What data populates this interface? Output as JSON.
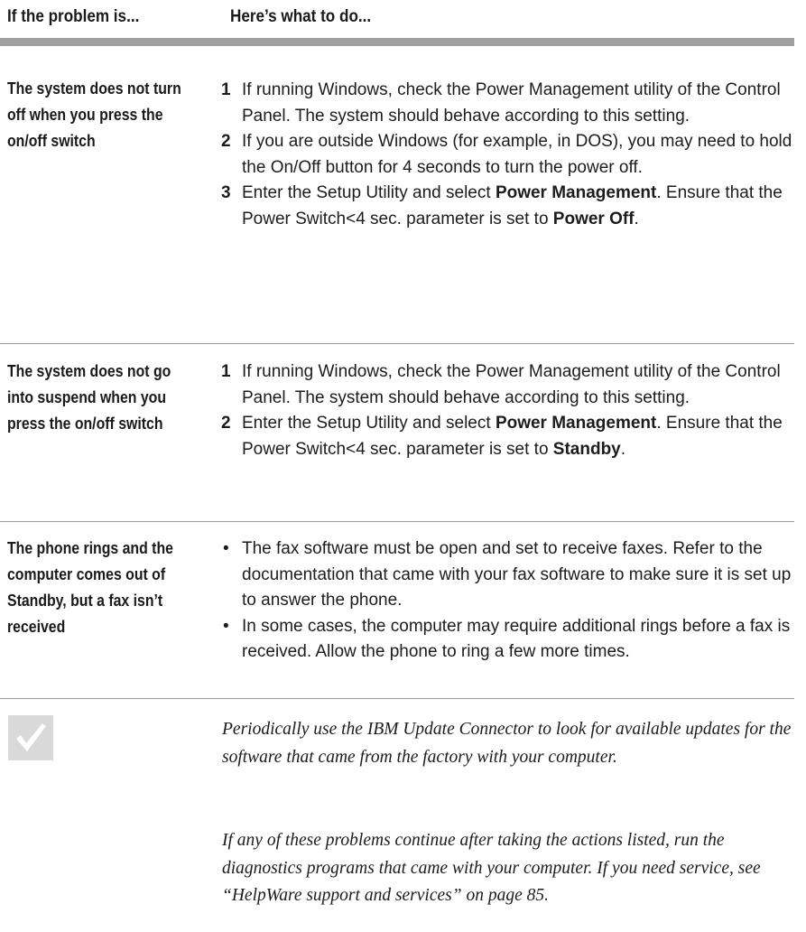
{
  "header": {
    "problem_col": "If the problem is...",
    "action_col": "Here’s what to do..."
  },
  "rows": [
    {
      "problem": "The system does not turn off when you press the on/off switch",
      "steps": [
        {
          "num": "1",
          "text": "If running Windows, check the Power Management utility of the Control Panel. The system should behave according to this setting."
        },
        {
          "num": "2",
          "text": "If you are outside Windows (for example, in DOS), you may need to hold the On/Off button for 4 seconds to turn the power off."
        },
        {
          "num": "3",
          "pre": "Enter the Setup Utility and select ",
          "bold1": "Power Management",
          "mid": ". Ensure that the Power Switch<4 sec. parameter is set to ",
          "bold2": "Power Off",
          "post": "."
        }
      ]
    },
    {
      "problem": "The system does not go into suspend when you press the on/off switch",
      "steps": [
        {
          "num": "1",
          "text": "If running Windows, check the Power Management utility of the Control Panel. The system should behave according to this setting."
        },
        {
          "num": "2",
          "pre": "Enter the Setup Utility and select ",
          "bold1": "Power Management",
          "mid": ". Ensure that the Power Switch<4 sec. parameter is set to ",
          "bold2": "Standby",
          "post": "."
        }
      ]
    },
    {
      "problem": "The phone rings and the computer comes out of Standby, but a fax isn’t received",
      "bullet": "•",
      "items": [
        "The fax software must be open and set to receive faxes. Refer to the documentation that came with your fax software to make sure it is set up to answer the phone.",
        "In some cases, the computer may require additional rings before a fax is received. Allow the phone to ring a few more times."
      ]
    }
  ],
  "note": {
    "icon": "checkmark-icon",
    "icon_color": "#d9d9d9",
    "paragraphs": [
      "Periodically use the IBM Update Connector to look for available updates for the software that came from the factory with your computer.",
      "If any of these problems continue after taking the actions listed, run the diagnostics programs that came with your computer. If you need service, see “HelpWare support and services” on page 85."
    ]
  }
}
